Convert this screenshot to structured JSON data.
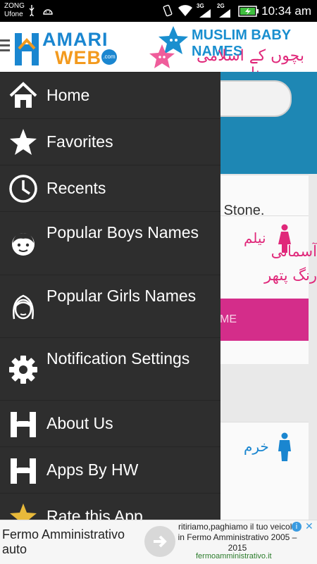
{
  "status_bar": {
    "carrier_1": "ZONG",
    "carrier_2": "Ufone",
    "network_1": "3G",
    "network_2": "2G",
    "time": "10:34 am",
    "icons": [
      "usb-icon",
      "android-debug-icon",
      "vibrate-icon",
      "wifi-icon",
      "signal-icon",
      "battery-icon"
    ]
  },
  "header": {
    "logo_h": "H",
    "logo_line1": "AMARI",
    "logo_line2": "WEB",
    "logo_suffix": ".com",
    "app_title": "MUSLIM BABY NAMES",
    "app_title_urdu": "بچوں کے اسلامی نام"
  },
  "drawer": {
    "items": [
      {
        "label": "Home",
        "icon": "home-icon"
      },
      {
        "label": "Favorites",
        "icon": "star-icon"
      },
      {
        "label": "Recents",
        "icon": "clock-icon"
      },
      {
        "label": "Popular Boys Names",
        "icon": "boy-face-icon"
      },
      {
        "label": "Popular Girls Names",
        "icon": "girl-face-icon"
      },
      {
        "label": "Notification Settings",
        "icon": "gear-icon"
      },
      {
        "label": "About Us",
        "icon": "hw-logo-icon"
      },
      {
        "label": "Apps By HW",
        "icon": "hw-logo-icon"
      },
      {
        "label": "Rate this App",
        "icon": "rating-star-icon"
      }
    ]
  },
  "background": {
    "name_urdu_1": "نیلم",
    "meaning_partial": "s Stone.",
    "meaning_urdu": "آسمانی رنگ پتھر",
    "button_partial": "ME",
    "name_urdu_2": "خرم"
  },
  "ad": {
    "title": "Fermo Amministrativo auto",
    "body": "ritiriamo,paghiamo il tuo veicolo in Fermo Amministrativo 2005 – 2015",
    "domain": "fermoamministrativo.it",
    "info_label": "i",
    "close_label": "✕"
  },
  "colors": {
    "drawer_bg": "#2e2e2e",
    "brand_blue": "#1a86d0",
    "brand_orange": "#f39a1e",
    "accent_pink": "#e0287a",
    "teal": "#1e87b4"
  }
}
